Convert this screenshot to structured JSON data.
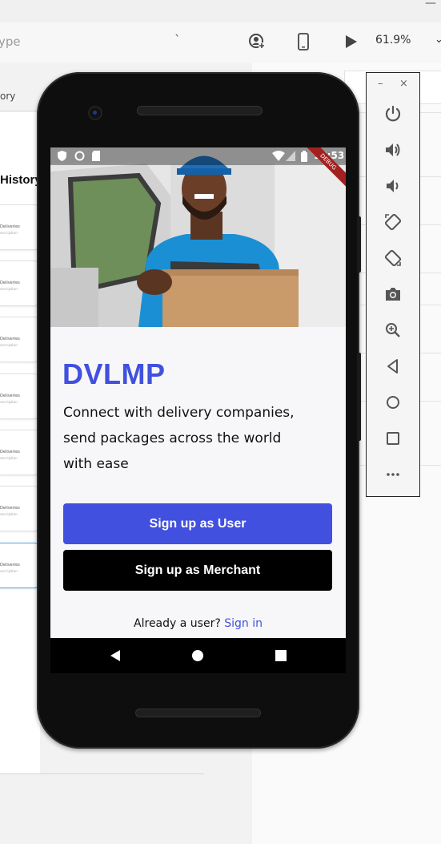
{
  "window": {
    "close_glyph": "—"
  },
  "toolbar": {
    "type_field": "ype",
    "zoom": "61.9%",
    "icons": [
      "user-add-icon",
      "device-preview-icon",
      "play-icon"
    ]
  },
  "left_panel": {
    "tab_label": "ory",
    "section_title": "History",
    "cards": [
      {
        "title": "Deliveries",
        "subtitle": "escription"
      },
      {
        "title": "Deliveries",
        "subtitle": "escription"
      },
      {
        "title": "Deliveries",
        "subtitle": "escription"
      },
      {
        "title": "Deliveries",
        "subtitle": "escription"
      },
      {
        "title": "Deliveries",
        "subtitle": "escription"
      },
      {
        "title": "Deliveries",
        "subtitle": "escription"
      },
      {
        "title": "Deliveries",
        "subtitle": "escription"
      }
    ]
  },
  "phone": {
    "status_time": "10:53",
    "debug_banner": "DEBUG",
    "app": {
      "brand": "DVLMP",
      "tagline": "Connect with delivery companies, send packages across the world with ease",
      "signup_user": "Sign up as User",
      "signup_merchant": "Sign up as Merchant",
      "signin_prompt": "Already a user?",
      "signin_link": "Sign in"
    },
    "colors": {
      "primary": "#4150de",
      "merchant": "#000000"
    }
  },
  "emulator_panel": {
    "minimize": "–",
    "close": "×",
    "buttons": [
      "power-icon",
      "volume-up-icon",
      "volume-down-icon",
      "rotate-left-icon",
      "rotate-right-icon",
      "camera-icon",
      "zoom-icon",
      "back-icon",
      "home-icon",
      "overview-icon",
      "more-icon"
    ]
  }
}
